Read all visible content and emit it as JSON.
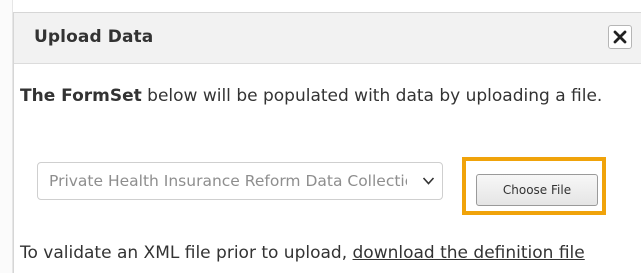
{
  "dialog": {
    "title": "Upload Data",
    "close_icon": "close-icon"
  },
  "intro": {
    "bold": "The FormSet",
    "text": " below will be populated with data by uploading a file."
  },
  "form_select": {
    "selected": "Private Health Insurance Reform Data Collection",
    "chevron_icon": "chevron-down-icon"
  },
  "choose_file": {
    "label": "Choose File"
  },
  "validate": {
    "text": "To validate an XML file prior to upload, ",
    "link": "download the definition file"
  },
  "colors": {
    "highlight": "#f0a30a",
    "header_bg": "#f2f2f2",
    "text": "#333333",
    "placeholder": "#8e8e8e"
  }
}
